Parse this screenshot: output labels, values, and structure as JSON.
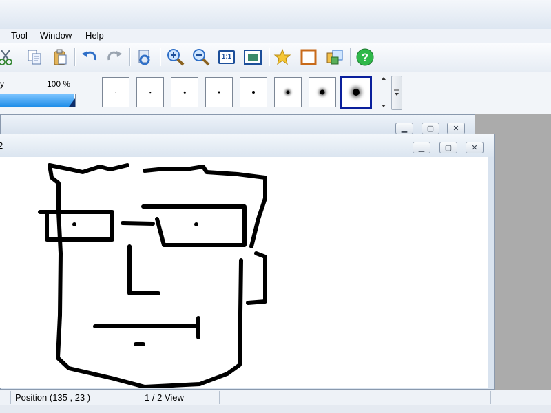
{
  "menu": {
    "items": [
      {
        "label": "Tool"
      },
      {
        "label": "Window"
      },
      {
        "label": "Help"
      }
    ]
  },
  "toolbar": {
    "buttons": [
      "cut-icon",
      "copy-icon",
      "paste-icon",
      "undo-icon",
      "redo-icon",
      "rotate-icon",
      "zoom-in-icon",
      "zoom-out-icon",
      "actual-size-icon",
      "fit-window-icon",
      "star-icon",
      "frame-icon",
      "layers-icon",
      "help-icon"
    ],
    "actual_size_label": "1:1"
  },
  "brush_panel": {
    "opacity_label": "y",
    "opacity_value": "100 %",
    "opacity_fraction": 1.0,
    "brushes": [
      {
        "dot": 1
      },
      {
        "dot": 1.5
      },
      {
        "dot": 2.5
      },
      {
        "dot": 3
      },
      {
        "dot": 4
      },
      {
        "dot": 5,
        "soft": true
      },
      {
        "dot": 7,
        "soft": true
      },
      {
        "dot": 10,
        "soft": true,
        "selected": true
      }
    ]
  },
  "windows": {
    "back": {
      "title": ""
    },
    "front": {
      "title": "2"
    }
  },
  "status": {
    "position": "Position (135 , 23 )",
    "view": "1 / 2 View"
  },
  "colors": {
    "selected_brush_border": "#0a1f9c",
    "opacity_fill": "#1f8de8",
    "help_green": "#2fb84a"
  }
}
